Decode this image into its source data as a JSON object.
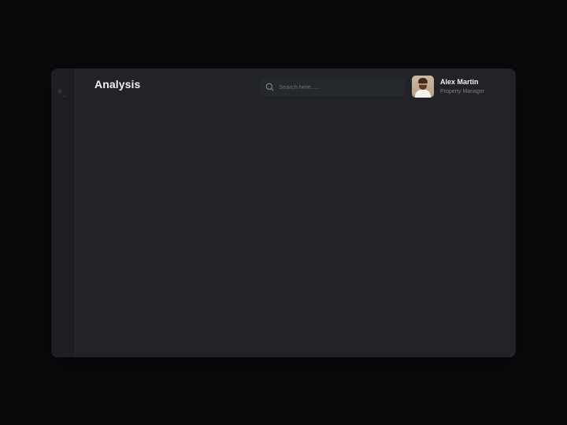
{
  "header": {
    "title": "Analysis"
  },
  "search": {
    "placeholder": "Search here.....",
    "value": "",
    "icon": "search-icon"
  },
  "user": {
    "name": "Alex Martin",
    "role": "Property Manager",
    "avatar_icon": "avatar"
  },
  "colors": {
    "background": "#0a0a0d",
    "panel": "#212327",
    "sidebar": "#1d1f23",
    "search_bg": "#25282c",
    "text_primary": "#f2f2f4",
    "text_secondary": "#7b7e86"
  }
}
